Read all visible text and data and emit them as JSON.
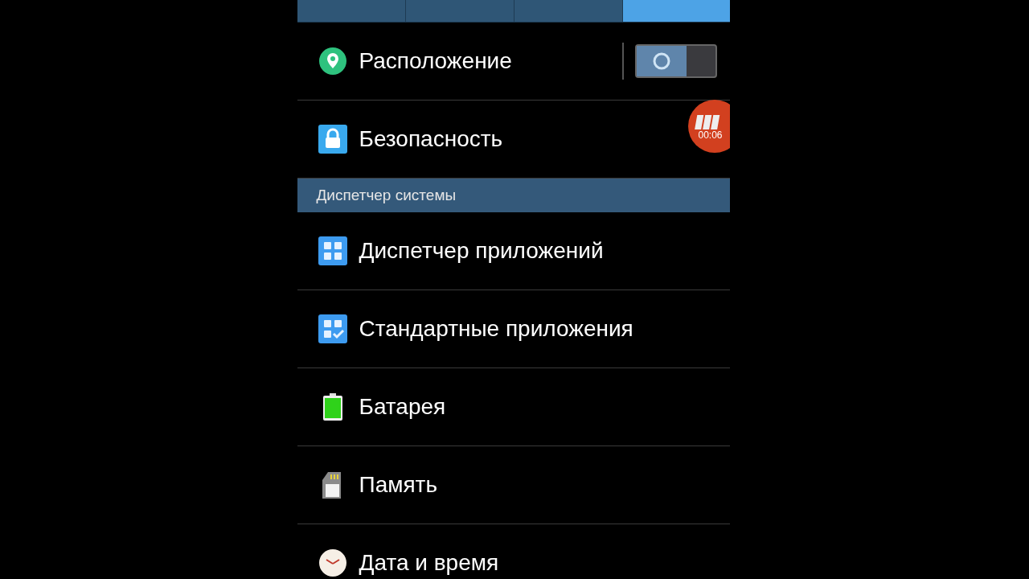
{
  "tabs": [
    {
      "selected": false
    },
    {
      "selected": false
    },
    {
      "selected": false
    },
    {
      "selected": true
    }
  ],
  "rows": [
    {
      "label": "Расположение",
      "kind": "switch",
      "on": false
    },
    {
      "label": "Безопасность",
      "kind": "plain"
    }
  ],
  "section": {
    "title": "Диспетчер системы"
  },
  "system_rows": [
    {
      "label": "Диспетчер приложений"
    },
    {
      "label": "Стандартные приложения"
    },
    {
      "label": "Батарея"
    },
    {
      "label": "Память"
    },
    {
      "label": "Дата и время"
    }
  ],
  "recorder": {
    "time": "00:06"
  }
}
